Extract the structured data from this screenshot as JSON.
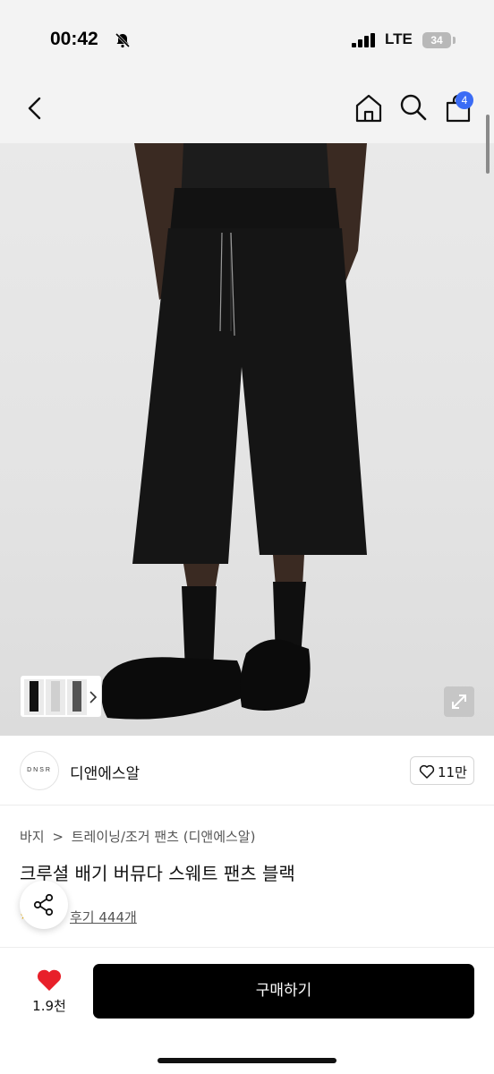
{
  "status_bar": {
    "time": "00:42",
    "network": "LTE",
    "battery": "34"
  },
  "nav": {
    "back_icon": "chevron-left-icon",
    "home_icon": "home-icon",
    "search_icon": "search-icon",
    "cart_icon": "shopping-bag-icon",
    "cart_count": "4"
  },
  "brand": {
    "logo_text": "DNSR",
    "name": "디앤에스알",
    "like_count": "11만"
  },
  "product": {
    "breadcrumb": [
      "바지",
      ">",
      "트레이닝/조거 팬츠 (디앤에스알)"
    ],
    "title": "크루셜 배기 버뮤다 스웨트 팬츠 블랙",
    "reviews": "후기 444개"
  },
  "bottom_bar": {
    "wish_count": "1.9천",
    "buy_label": "구매하기"
  },
  "colors": {
    "accent": "#3b6cf5",
    "heart": "#e8202a",
    "buy_button": "#000000"
  }
}
